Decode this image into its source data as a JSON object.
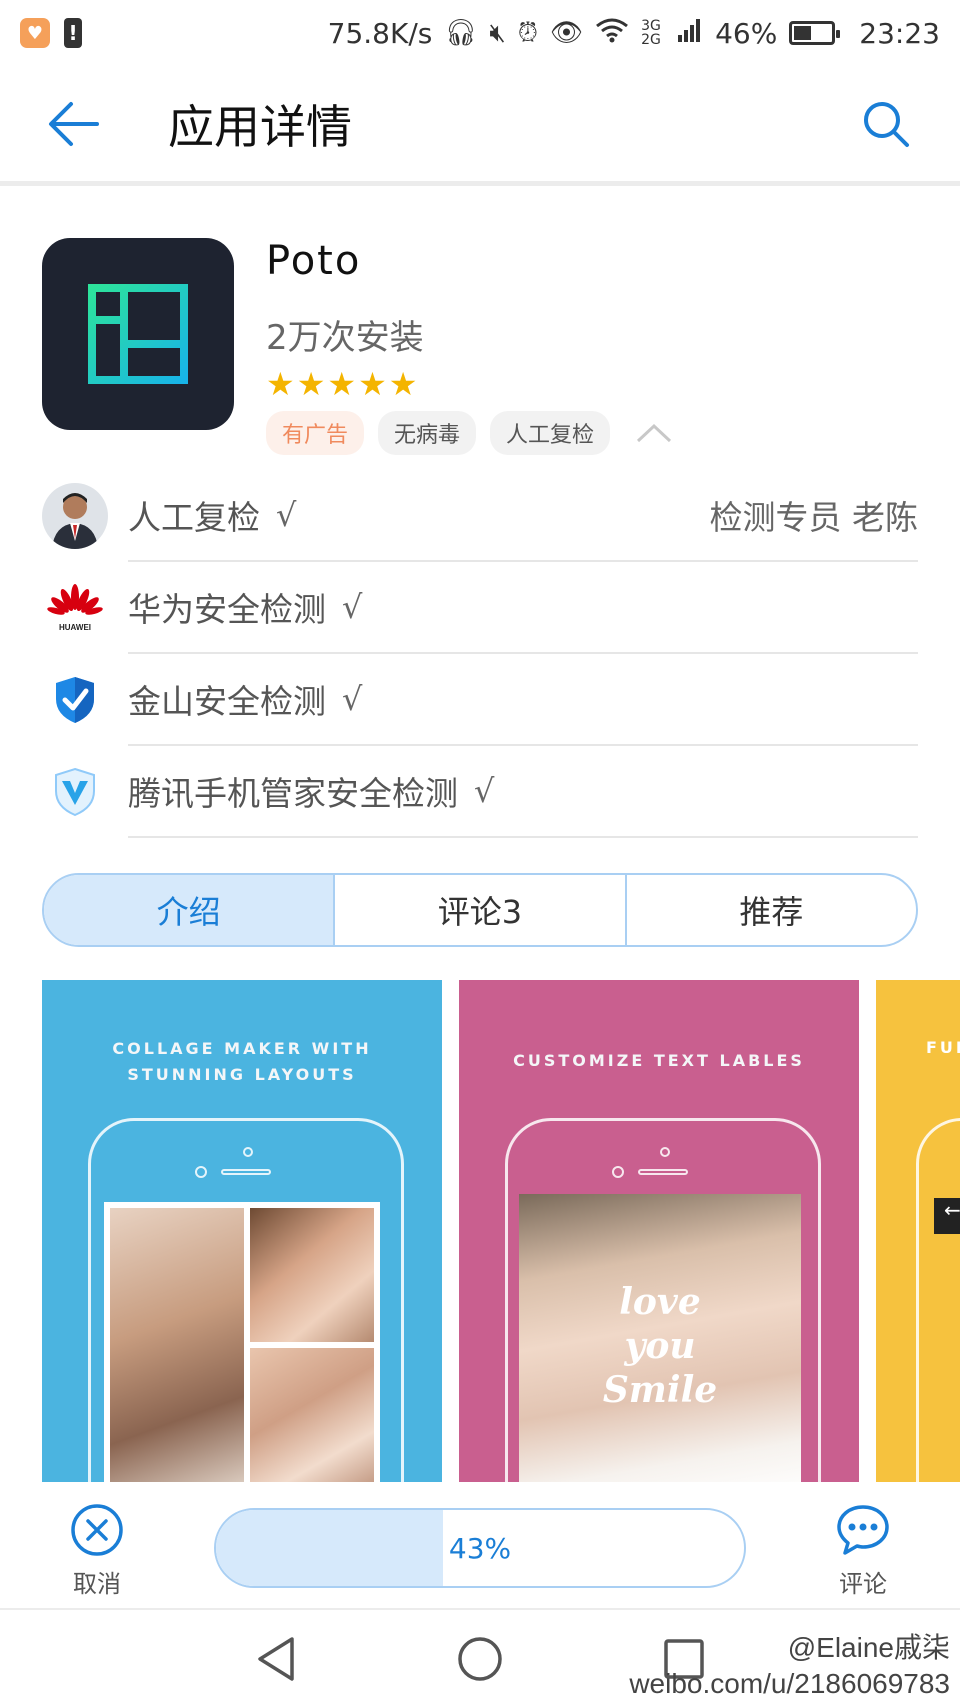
{
  "status_bar": {
    "net_speed": "75.8K/s",
    "network": "3G 2G",
    "battery": "46%",
    "time": "23:23"
  },
  "app_bar": {
    "title": "应用详情"
  },
  "app": {
    "name": "Poto",
    "installs": "2万次安装",
    "rating_stars": "★★★★★",
    "rating": 5,
    "tags": [
      "有广告",
      "无病毒",
      "人工复检"
    ]
  },
  "security_checks": [
    {
      "label": "人工复检",
      "check": "√",
      "right": "检测专员  老陈",
      "icon": "reviewer-avatar"
    },
    {
      "label": "华为安全检测",
      "check": "√",
      "icon": "huawei-logo",
      "icon_text": "HUAWEI"
    },
    {
      "label": "金山安全检测",
      "check": "√",
      "icon": "shield-check-icon"
    },
    {
      "label": "腾讯手机管家安全检测",
      "check": "√",
      "icon": "shield-v-icon"
    }
  ],
  "tabs": [
    {
      "label": "介绍",
      "active": true
    },
    {
      "label": "评论3",
      "active": false
    },
    {
      "label": "推荐",
      "active": false
    }
  ],
  "screenshots": [
    {
      "caption": [
        "COLLAGE MAKER WITH",
        "STUNNING LAYOUTS"
      ],
      "color": "#4bb4e0"
    },
    {
      "caption": [
        "CUSTOMIZE TEXT LABLES"
      ],
      "overlay": [
        "love",
        "you",
        "Smile"
      ],
      "color": "#c95f8f"
    },
    {
      "caption": [
        "FUN"
      ],
      "bar": "←",
      "color": "#f6c23e"
    }
  ],
  "actions": {
    "cancel_label": "取消",
    "progress": 43,
    "progress_text": "43%",
    "comment_label": "评论"
  },
  "watermark": {
    "line1": "@Elaine戚柒",
    "line2": "weibo.com/u/2186069783"
  },
  "colors": {
    "accent": "#1a7ed6",
    "accent_light": "#d6e9fb",
    "star": "#f4b400"
  }
}
